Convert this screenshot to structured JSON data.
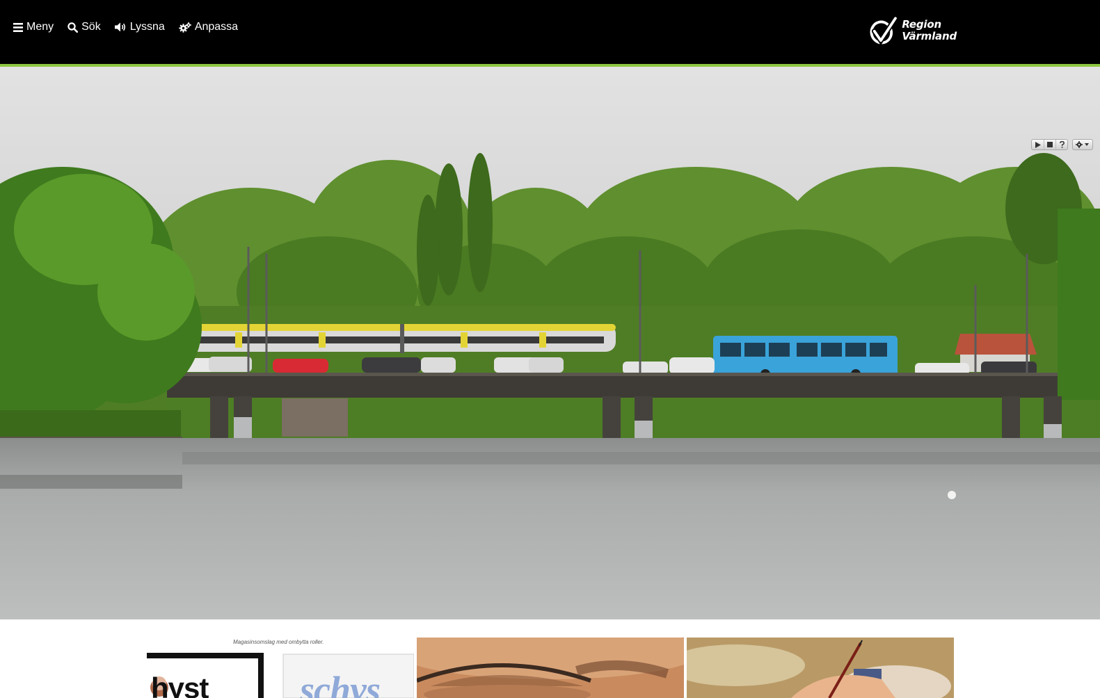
{
  "header": {
    "menu_label": "Meny",
    "search_label": "Sök",
    "listen_label": "Lyssna",
    "customize_label": "Anpassa",
    "logo_line1": "Region",
    "logo_line2": "Värmland",
    "accent_color": "#8cc63f",
    "background_color": "#000000"
  },
  "player": {
    "play_icon": "play-icon",
    "stop_icon": "stop-icon",
    "help_icon": "help-icon",
    "settings_icon": "gear-icon"
  },
  "thumbnails": [
    {
      "caption": "Magasinsomslag med ombytta roller.",
      "word1": "hyst",
      "word2": "schys"
    },
    {},
    {}
  ]
}
